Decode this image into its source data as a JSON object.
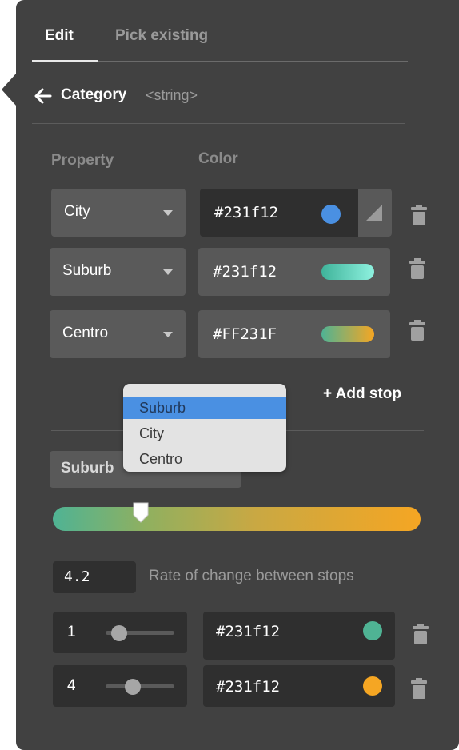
{
  "tabs": {
    "edit": "Edit",
    "pick_existing": "Pick existing"
  },
  "category": {
    "title": "Category",
    "type": "<string>"
  },
  "columns": {
    "property": "Property",
    "color": "Color"
  },
  "stops": [
    {
      "property": "City",
      "color": "#231f12",
      "swatch": "#4a90e2"
    },
    {
      "property": "Suburb",
      "color": "#231f12",
      "swatch_from": "#3fb39a",
      "swatch_to": "#8ef1df"
    },
    {
      "property": "Centro",
      "color": "#FF231F",
      "swatch_from": "#4fb394",
      "swatch_to": "#f5a623"
    }
  ],
  "add_stop_label": "+ Add stop",
  "dropdown": {
    "options": [
      "Suburb",
      "City",
      "Centro"
    ],
    "selected": "Suburb"
  },
  "interpolation": {
    "property": "Suburb",
    "handle_position": 0.24,
    "rate_value": "4.2",
    "rate_label": "Rate of change between stops"
  },
  "value_stops": [
    {
      "value": "1",
      "level": 0.2,
      "color": "#231f12",
      "swatch": "#4fb394"
    },
    {
      "value": "4",
      "level": 0.4,
      "color": "#231f12",
      "swatch": "#f5a623"
    }
  ]
}
